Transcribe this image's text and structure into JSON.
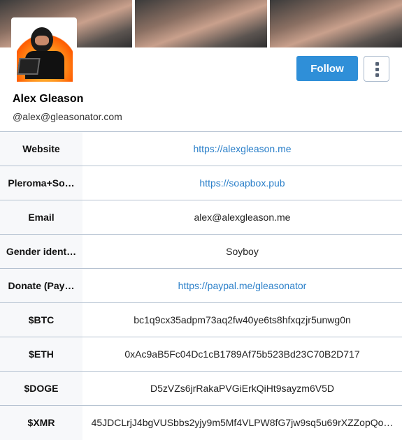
{
  "profile": {
    "display_name": "Alex Gleason",
    "handle": "@alex@gleasonator.com",
    "follow_label": "Follow",
    "more_icon": "vertical-ellipsis-icon",
    "accent_color": "#2f8fd8"
  },
  "fields": [
    {
      "label": "Website",
      "value": "https://alexgleason.me",
      "link": true
    },
    {
      "label": "Pleroma+So…",
      "value": "https://soapbox.pub",
      "link": true
    },
    {
      "label": "Email",
      "value": "alex@alexgleason.me",
      "link": false
    },
    {
      "label": "Gender ident…",
      "value": "Soyboy",
      "link": false
    },
    {
      "label": "Donate (Pay…",
      "value": "https://paypal.me/gleasonator",
      "link": true
    },
    {
      "label": "$BTC",
      "value": "bc1q9cx35adpm73aq2fw40ye6ts8hfxqzjr5unwg0n",
      "link": false
    },
    {
      "label": "$ETH",
      "value": "0xAc9aB5Fc04Dc1cB1789Af75b523Bd23C70B2D717",
      "link": false
    },
    {
      "label": "$DOGE",
      "value": "D5zVZs6jrRakaPVGiErkQiHt9sayzm6V5D",
      "link": false
    },
    {
      "label": "$XMR",
      "value": "45JDCLrjJ4bgVUSbbs2yjy9m5Mf4VLPW8fG7jw9sq5u69rXZZopQo…",
      "link": false
    }
  ]
}
